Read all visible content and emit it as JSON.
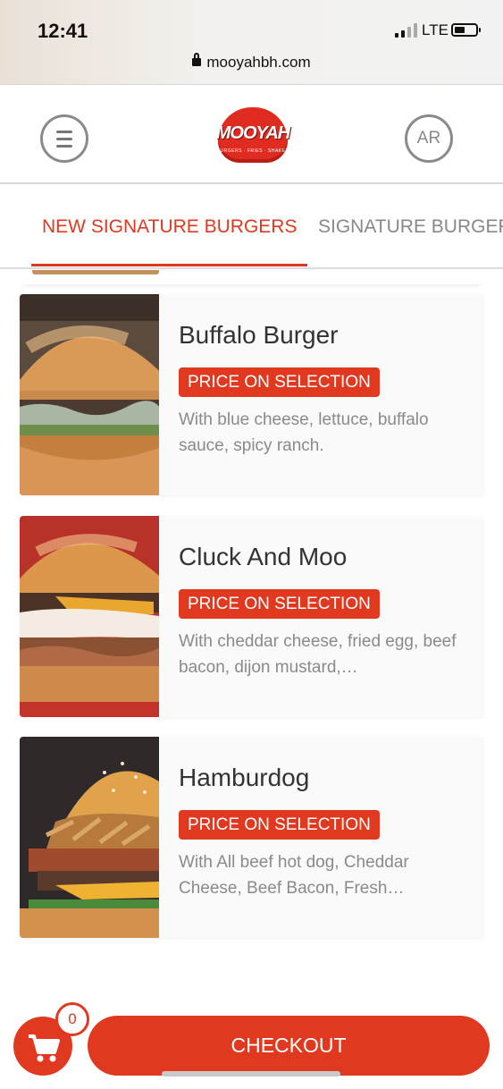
{
  "status_bar": {
    "time": "12:41",
    "network": "LTE",
    "url": "mooyahbh.com"
  },
  "header": {
    "logo_text": "MOOYAH",
    "logo_tagline": "BURGERS · FRIES · SHAKES",
    "language_button": "AR"
  },
  "tabs": [
    {
      "label": "NEW SIGNATURE BURGERS",
      "active": true
    },
    {
      "label": "SIGNATURE BURGERS",
      "active": false
    }
  ],
  "menu_items": [
    {
      "name": "Buffalo Burger",
      "price_label": "PRICE ON SELECTION",
      "description": "With blue cheese, lettuce, buffalo sauce, spicy ranch."
    },
    {
      "name": "Cluck And Moo",
      "price_label": "PRICE ON SELECTION",
      "description": "With cheddar cheese, fried egg, beef bacon, dijon mustard,…"
    },
    {
      "name": "Hamburdog",
      "price_label": "PRICE ON SELECTION",
      "description": "With All beef hot dog, Cheddar Cheese, Beef Bacon, Fresh…"
    }
  ],
  "cart": {
    "count": "0"
  },
  "checkout_label": "CHECKOUT",
  "colors": {
    "accent": "#e0391f",
    "text": "#333333",
    "muted": "#8a8a8a"
  }
}
